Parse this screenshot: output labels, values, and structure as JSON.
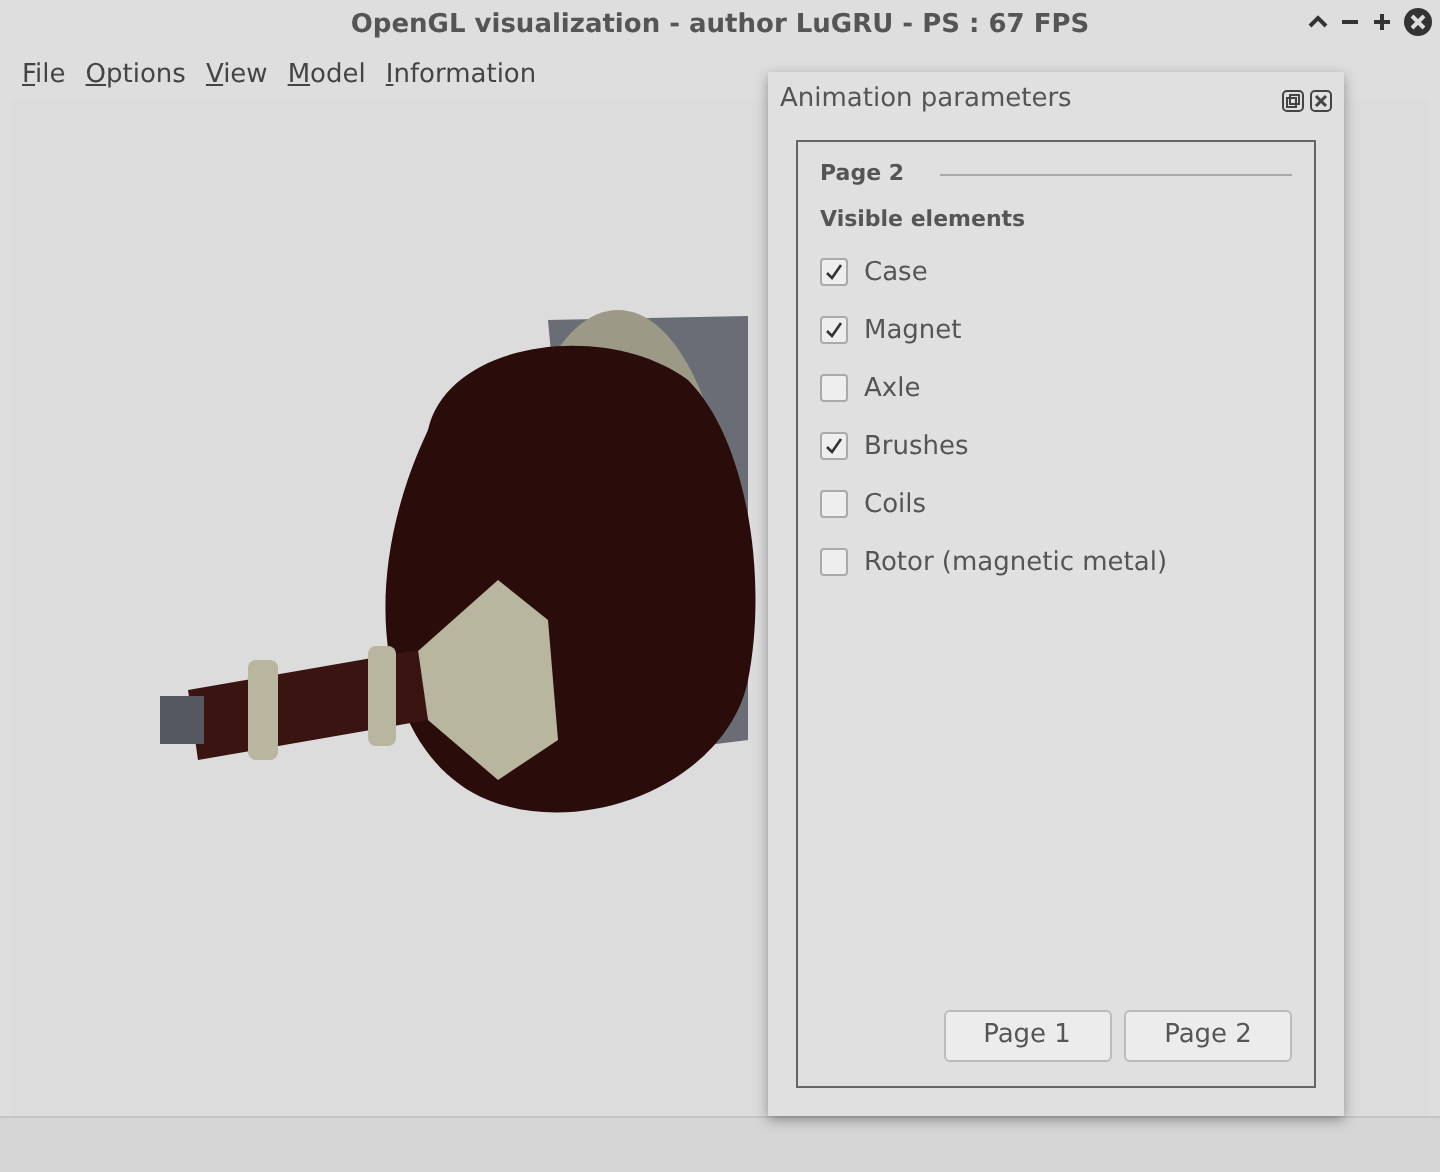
{
  "window": {
    "title": "OpenGL visualization - author LuGRU - PS : 67 FPS"
  },
  "menu": [
    {
      "label": "File"
    },
    {
      "label": "Options"
    },
    {
      "label": "View"
    },
    {
      "label": "Model"
    },
    {
      "label": "Information"
    }
  ],
  "dialog": {
    "title": "Animation parameters",
    "page_title": "Page 2",
    "section": "Visible elements",
    "items": [
      {
        "label": "Case",
        "checked": true
      },
      {
        "label": "Magnet",
        "checked": true
      },
      {
        "label": "Axle",
        "checked": false
      },
      {
        "label": "Brushes",
        "checked": true
      },
      {
        "label": "Coils",
        "checked": false
      },
      {
        "label": "Rotor (magnetic metal)",
        "checked": false
      }
    ],
    "buttons": [
      {
        "label": "Page 1"
      },
      {
        "label": "Page 2"
      }
    ]
  }
}
